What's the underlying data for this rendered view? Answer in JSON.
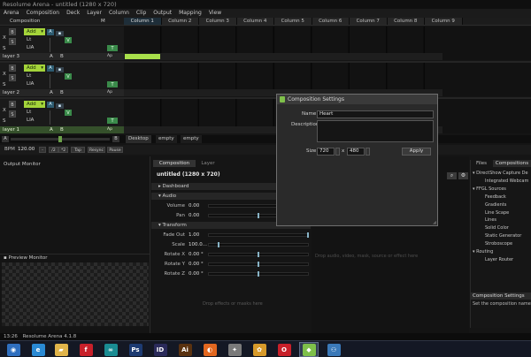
{
  "window": {
    "title": "Resolume Arena - untitled (1280 x 720)"
  },
  "menu": [
    "Arena",
    "Composition",
    "Deck",
    "Layer",
    "Column",
    "Clip",
    "Output",
    "Mapping",
    "View"
  ],
  "header": {
    "composition_label": "Composition",
    "m_label": "M"
  },
  "columns": [
    "Column 1",
    "Column 2",
    "Column 3",
    "Column 4",
    "Column 5",
    "Column 6",
    "Column 7",
    "Column 8",
    "Column 9"
  ],
  "layer_controls": {
    "x": "X",
    "s": "S",
    "b": "B",
    "add": "Add",
    "lt": "Lt",
    "lia": "LIA",
    "v": "V",
    "t": "T",
    "a": "A",
    "b2": "B",
    "ap": "Ap"
  },
  "layers": [
    {
      "name": "layer 3"
    },
    {
      "name": "layer 2"
    },
    {
      "name": "layer 1"
    }
  ],
  "deck_bar": {
    "a": "A",
    "b": "B",
    "tabs": [
      "Desktop",
      "empty",
      "empty"
    ]
  },
  "transport": {
    "bpm_label": "BPM",
    "bpm_value": "120.00",
    "minus": "-",
    "div2": "/2",
    "plus2": "*2",
    "tap": "Tap",
    "resync": "Resync",
    "pause": "Pause"
  },
  "panels": {
    "output_monitor": "Output Monitor",
    "preview_monitor": "Preview Monitor",
    "composition_tab": "Composition",
    "layer_tab": "Layer",
    "comp_name": "untitled (1280 x 720)",
    "drop_effects": "Drop effects or masks here",
    "drop_audio": "Drop audio, video, mask, source or effect here"
  },
  "sections": {
    "dashboard": "Dashboard",
    "audio": "Audio",
    "transform": "Transform"
  },
  "params": [
    {
      "label": "Volume",
      "value": "0.00",
      "level": 1.0
    },
    {
      "label": "Pan",
      "value": "0.00",
      "level": 0.5
    },
    {
      "label": "Fade Out",
      "value": "1.00",
      "level": 1.0
    },
    {
      "label": "Scale",
      "value": "100.0...",
      "level": 0.1
    },
    {
      "label": "Rotate X",
      "value": "0.00 °",
      "level": 0.5
    },
    {
      "label": "Rotate Y",
      "value": "0.00 °",
      "level": 0.5
    },
    {
      "label": "Rotate Z",
      "value": "0.00 °",
      "level": 0.5
    }
  ],
  "right_panel": {
    "files_tab": "Files",
    "compositions_tab": "Compositions",
    "tree": [
      {
        "text": "DirectShow Capture De",
        "indent": 1,
        "arrow": "▾"
      },
      {
        "text": "Integrated Webcam",
        "indent": 2,
        "arrow": ""
      },
      {
        "text": "FFGL Sources",
        "indent": 1,
        "arrow": "▾"
      },
      {
        "text": "Feedback",
        "indent": 2,
        "arrow": ""
      },
      {
        "text": "Gradients",
        "indent": 2,
        "arrow": ""
      },
      {
        "text": "Line Scape",
        "indent": 2,
        "arrow": ""
      },
      {
        "text": "Lines",
        "indent": 2,
        "arrow": ""
      },
      {
        "text": "Solid Color",
        "indent": 2,
        "arrow": ""
      },
      {
        "text": "Static Generator",
        "indent": 2,
        "arrow": ""
      },
      {
        "text": "Stroboscope",
        "indent": 2,
        "arrow": ""
      },
      {
        "text": "Routing",
        "indent": 1,
        "arrow": "▾"
      },
      {
        "text": "Layer Router",
        "indent": 2,
        "arrow": ""
      }
    ],
    "help_title": "Composition Settings",
    "help_text": "Set the composition name, des"
  },
  "dialog": {
    "title": "Composition Settings",
    "name_label": "Name",
    "name_value": "Heart",
    "desc_label": "Description",
    "desc_value": "",
    "size_label": "Size",
    "width": "720",
    "x": "x",
    "height": "480",
    "apply": "Apply"
  },
  "status": {
    "time": "13:26",
    "version": "Resolume Arena 4.1.8"
  },
  "taskbar": [
    {
      "icon": "start-orb-icon",
      "glyph": "◉",
      "color": "#2f6fbf"
    },
    {
      "icon": "internet-explorer-icon",
      "glyph": "e",
      "color": "#2a8ad4"
    },
    {
      "icon": "folder-icon",
      "glyph": "▰",
      "color": "#e0b44a"
    },
    {
      "icon": "flash-icon",
      "glyph": "f",
      "color": "#c8202a"
    },
    {
      "icon": "arduino-icon",
      "glyph": "∞",
      "color": "#1a8c93"
    },
    {
      "icon": "photoshop-icon",
      "glyph": "Ps",
      "color": "#1d3b72"
    },
    {
      "icon": "indesign-icon",
      "glyph": "ID",
      "color": "#2a2a5a"
    },
    {
      "icon": "illustrator-icon",
      "glyph": "Ai",
      "color": "#5a3210"
    },
    {
      "icon": "firefox-icon",
      "glyph": "◐",
      "color": "#e2671f"
    },
    {
      "icon": "ae-icon",
      "glyph": "✦",
      "color": "#7a7a7a"
    },
    {
      "icon": "transformer-icon",
      "glyph": "✿",
      "color": "#d79a2a"
    },
    {
      "icon": "opera-icon",
      "glyph": "O",
      "color": "#c8202a"
    },
    {
      "icon": "resolume-icon",
      "glyph": "◆",
      "color": "#7ec04a"
    },
    {
      "icon": "python-icon",
      "glyph": "⚇",
      "color": "#3b79b8"
    }
  ]
}
